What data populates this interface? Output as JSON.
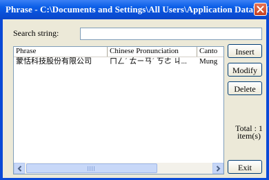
{
  "window": {
    "title": "Phrase - C:\\Documents and Settings\\All Users\\Application Data\\WIN..."
  },
  "search": {
    "label": "Search string:",
    "value": "",
    "placeholder": ""
  },
  "table": {
    "columns": [
      "Phrase",
      "Chinese Pronunciation",
      "Canto"
    ],
    "rows": [
      {
        "phrase": "蒙恬科技股份有限公司",
        "pronunciation": "ㄇㄥˊ ㄊㄧㄢˊ ㄎㄜ ㄐ...",
        "canto": "Mung"
      }
    ]
  },
  "buttons": {
    "insert": "Insert",
    "modify": "Modify",
    "delete": "Delete",
    "exit": "Exit"
  },
  "status": {
    "total_label": "Total :",
    "count": "1",
    "unit": "item(s)"
  }
}
